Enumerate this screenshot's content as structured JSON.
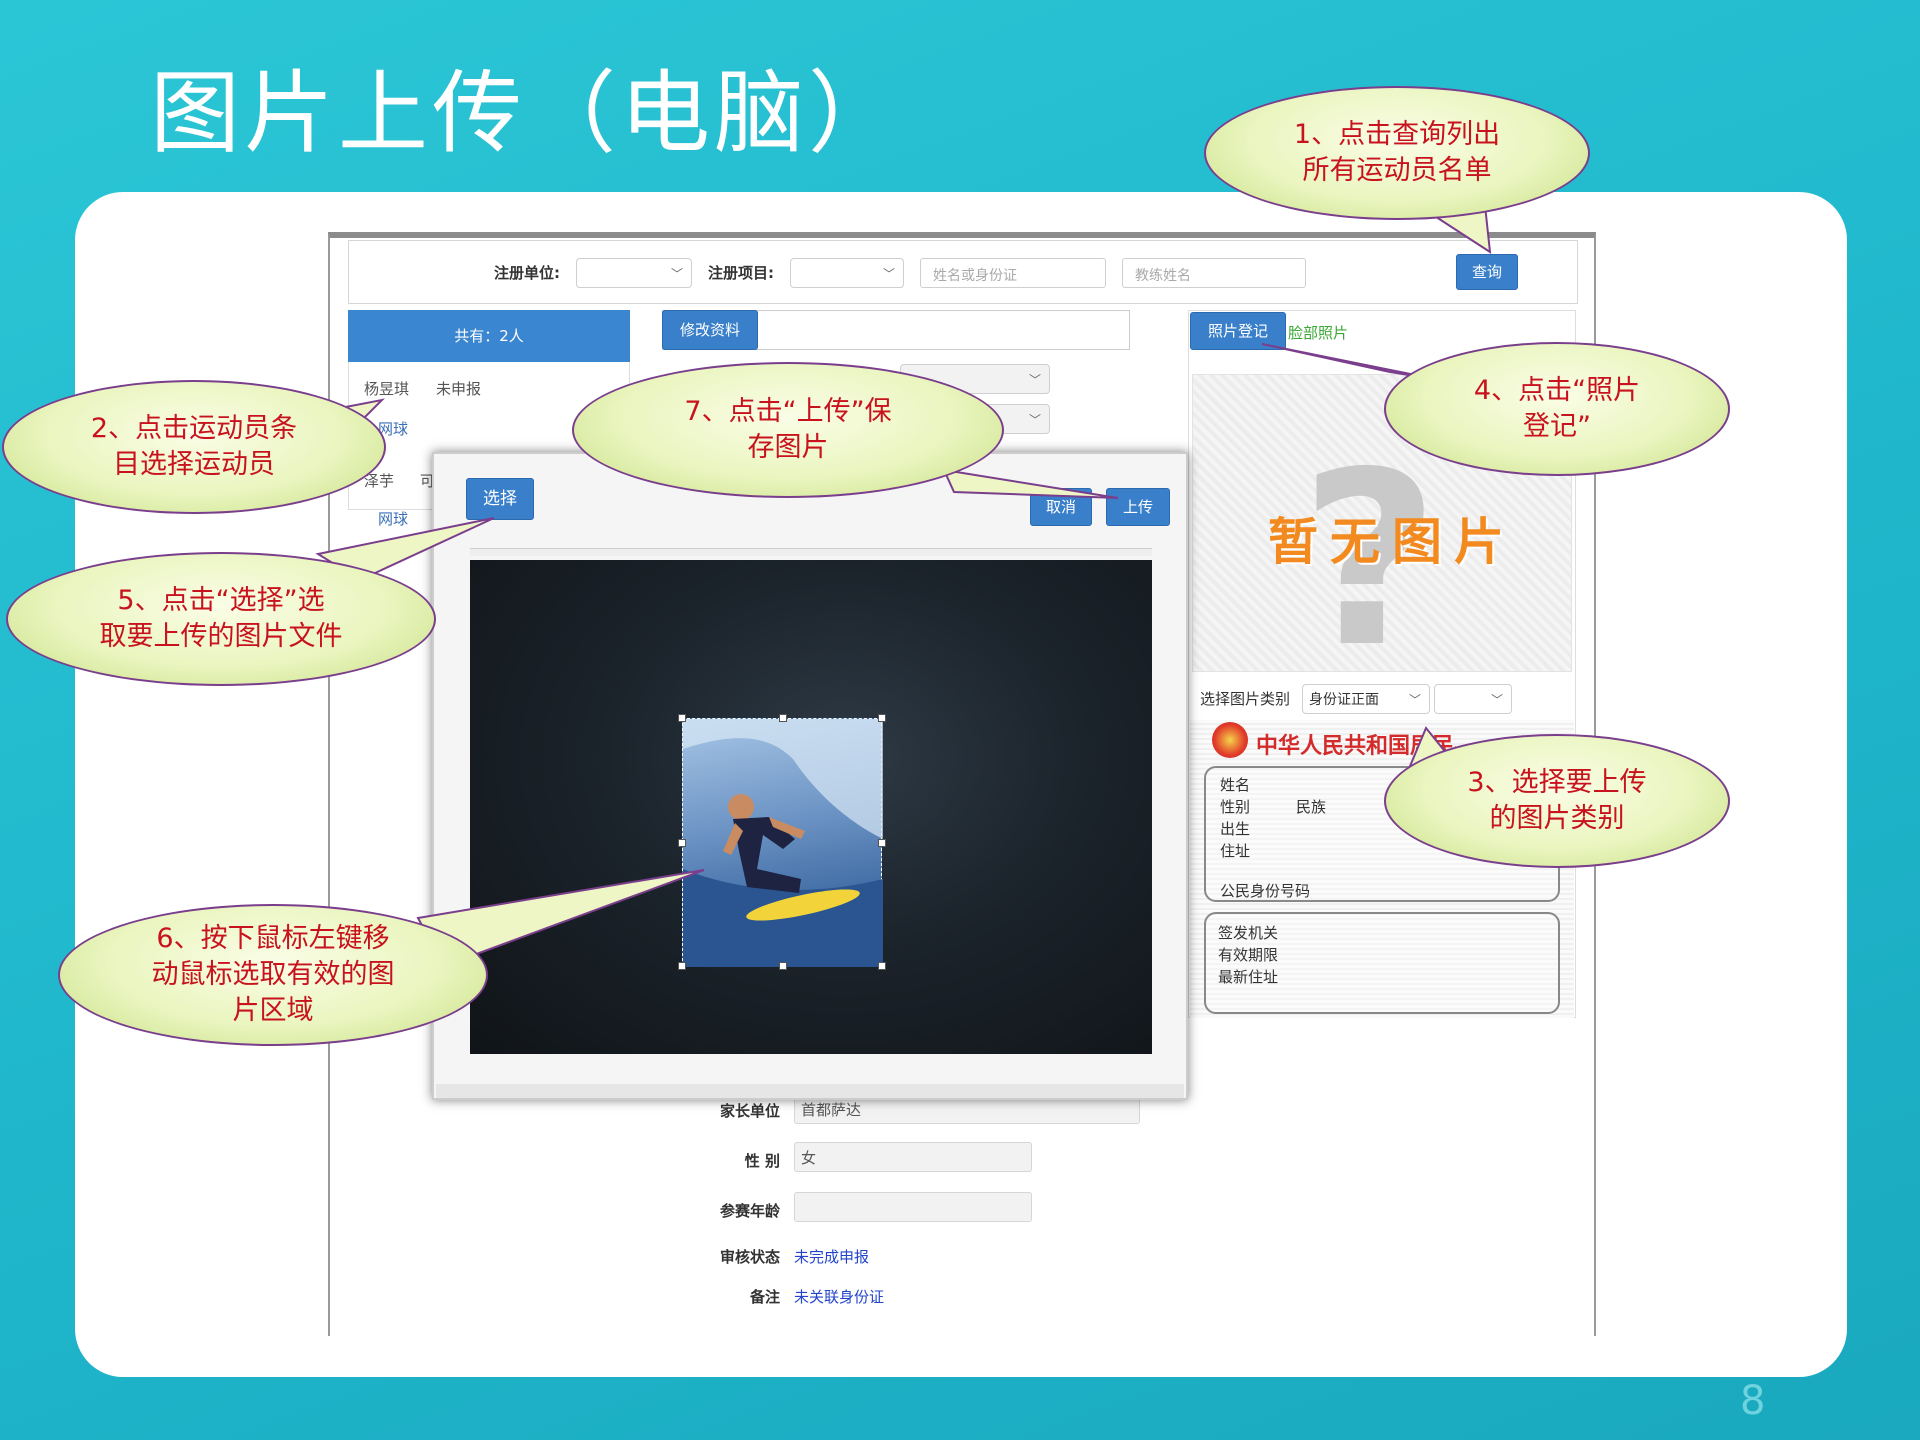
{
  "title": "图片上传（电脑）",
  "page_number": "8",
  "search_bar": {
    "unit_label": "注册单位:",
    "project_label": "注册项目:",
    "name_placeholder": "姓名或身份证",
    "coach_placeholder": "教练姓名",
    "query_button": "查询"
  },
  "left_panel": {
    "count_label": "共有：2人",
    "athletes": [
      {
        "name": "杨昱琪",
        "status": "未申报",
        "sport": "网球"
      },
      {
        "name": "泽芋",
        "status": "可",
        "sport": "网球"
      }
    ]
  },
  "middle_panel": {
    "edit_button": "修改资料",
    "fields": [
      {
        "label": "家长单位",
        "value": "首都萨达"
      },
      {
        "label": "性 别",
        "value": "女"
      },
      {
        "label": "参赛年龄",
        "value": ""
      },
      {
        "label": "审核状态",
        "value": "未完成申报"
      },
      {
        "label": "备注",
        "value": "未关联身份证"
      }
    ]
  },
  "right_panel": {
    "photo_register_tab": "照片登记",
    "face_photo_tab": "脸部照片",
    "no_image_text": "暂无图片",
    "category_label": "选择图片类别",
    "category_value": "身份证正面",
    "id_card": {
      "header": "中华人民共和国居民身份证",
      "front_lines": [
        "姓名",
        "性别",
        "民族",
        "出生",
        "住址",
        "公民身份号码"
      ],
      "back_lines": [
        "签发机关",
        "有效期限",
        "最新住址"
      ]
    }
  },
  "modal": {
    "select_button": "选择",
    "cancel_button": "取消",
    "upload_button": "上传"
  },
  "callouts": [
    {
      "id": "c1",
      "lines": [
        "1、点击查询列出",
        "所有运动员名单"
      ]
    },
    {
      "id": "c2",
      "lines": [
        "2、点击运动员条",
        "目选择运动员"
      ]
    },
    {
      "id": "c3",
      "lines": [
        "3、选择要上传",
        "的图片类别"
      ]
    },
    {
      "id": "c4",
      "lines": [
        "4、点击“照片",
        "登记”"
      ]
    },
    {
      "id": "c5",
      "lines": [
        "5、点击“选择”选",
        "取要上传的图片文件"
      ]
    },
    {
      "id": "c6",
      "lines": [
        "6、按下鼠标左键移",
        "动鼠标选取有效的图",
        "片区域"
      ]
    },
    {
      "id": "c7",
      "lines": [
        "7、点击“上传”保",
        "存图片"
      ]
    }
  ],
  "colors": {
    "slide_background": "#22bccf",
    "button_blue": "#3a7fc9",
    "callout_text": "#c8131e",
    "callout_fill": "#eaf5bf",
    "no_image_orange": "#f28a1f",
    "link_blue": "#2244cc"
  }
}
